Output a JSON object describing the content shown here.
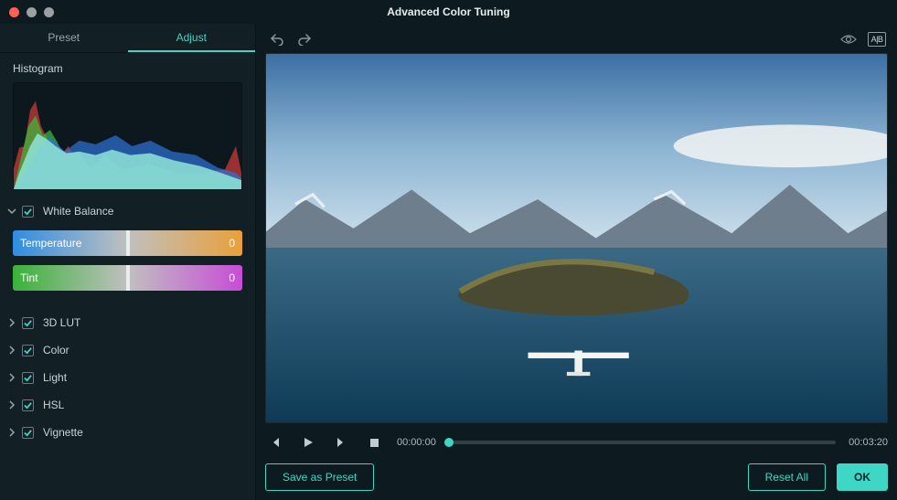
{
  "window": {
    "title": "Advanced Color Tuning"
  },
  "traffic_colors": [
    "#ff5f57",
    "#9aa0a4",
    "#9aa0a4"
  ],
  "tabs": {
    "preset": "Preset",
    "adjust": "Adjust",
    "active": "adjust"
  },
  "histogram": {
    "title": "Histogram"
  },
  "group": {
    "white_balance": {
      "label": "White Balance",
      "expanded": true,
      "temperature": {
        "label": "Temperature",
        "value": 0
      },
      "tint": {
        "label": "Tint",
        "value": 0
      }
    },
    "lut": {
      "label": "3D LUT",
      "expanded": false
    },
    "color": {
      "label": "Color",
      "expanded": false
    },
    "light": {
      "label": "Light",
      "expanded": false
    },
    "hsl": {
      "label": "HSL",
      "expanded": false
    },
    "vignette": {
      "label": "Vignette",
      "expanded": false
    }
  },
  "player": {
    "current": "00:00:00",
    "duration": "00:03:20",
    "progress": 0
  },
  "buttons": {
    "save_preset": "Save as Preset",
    "reset_all": "Reset All",
    "ok": "OK"
  },
  "compare_badge": "A|B",
  "colors": {
    "accent": "#3ed6c5",
    "temp_gradient": [
      "#2f8de0",
      "#c0c0c0",
      "#e9a03a"
    ],
    "tint_gradient": [
      "#3ab23a",
      "#c0c0c0",
      "#c74dd6"
    ]
  }
}
